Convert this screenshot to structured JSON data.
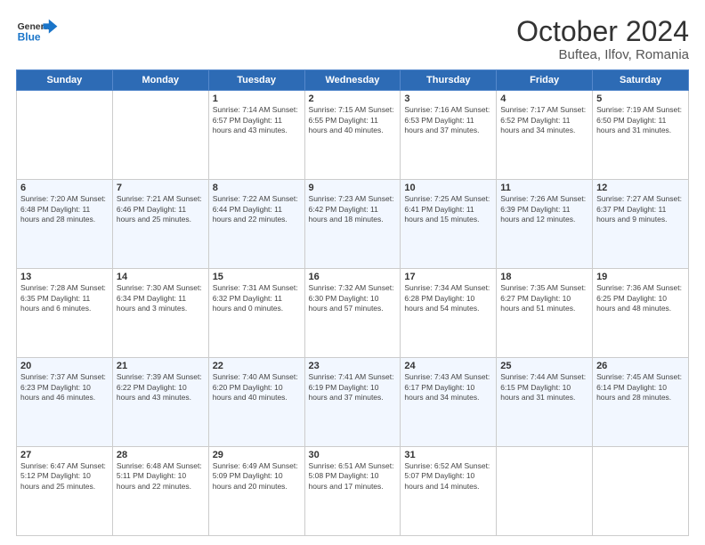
{
  "header": {
    "logo_line1": "General",
    "logo_line2": "Blue",
    "month": "October 2024",
    "location": "Buftea, Ilfov, Romania"
  },
  "weekdays": [
    "Sunday",
    "Monday",
    "Tuesday",
    "Wednesday",
    "Thursday",
    "Friday",
    "Saturday"
  ],
  "weeks": [
    [
      {
        "day": "",
        "info": ""
      },
      {
        "day": "",
        "info": ""
      },
      {
        "day": "1",
        "info": "Sunrise: 7:14 AM\nSunset: 6:57 PM\nDaylight: 11 hours and 43 minutes."
      },
      {
        "day": "2",
        "info": "Sunrise: 7:15 AM\nSunset: 6:55 PM\nDaylight: 11 hours and 40 minutes."
      },
      {
        "day": "3",
        "info": "Sunrise: 7:16 AM\nSunset: 6:53 PM\nDaylight: 11 hours and 37 minutes."
      },
      {
        "day": "4",
        "info": "Sunrise: 7:17 AM\nSunset: 6:52 PM\nDaylight: 11 hours and 34 minutes."
      },
      {
        "day": "5",
        "info": "Sunrise: 7:19 AM\nSunset: 6:50 PM\nDaylight: 11 hours and 31 minutes."
      }
    ],
    [
      {
        "day": "6",
        "info": "Sunrise: 7:20 AM\nSunset: 6:48 PM\nDaylight: 11 hours and 28 minutes."
      },
      {
        "day": "7",
        "info": "Sunrise: 7:21 AM\nSunset: 6:46 PM\nDaylight: 11 hours and 25 minutes."
      },
      {
        "day": "8",
        "info": "Sunrise: 7:22 AM\nSunset: 6:44 PM\nDaylight: 11 hours and 22 minutes."
      },
      {
        "day": "9",
        "info": "Sunrise: 7:23 AM\nSunset: 6:42 PM\nDaylight: 11 hours and 18 minutes."
      },
      {
        "day": "10",
        "info": "Sunrise: 7:25 AM\nSunset: 6:41 PM\nDaylight: 11 hours and 15 minutes."
      },
      {
        "day": "11",
        "info": "Sunrise: 7:26 AM\nSunset: 6:39 PM\nDaylight: 11 hours and 12 minutes."
      },
      {
        "day": "12",
        "info": "Sunrise: 7:27 AM\nSunset: 6:37 PM\nDaylight: 11 hours and 9 minutes."
      }
    ],
    [
      {
        "day": "13",
        "info": "Sunrise: 7:28 AM\nSunset: 6:35 PM\nDaylight: 11 hours and 6 minutes."
      },
      {
        "day": "14",
        "info": "Sunrise: 7:30 AM\nSunset: 6:34 PM\nDaylight: 11 hours and 3 minutes."
      },
      {
        "day": "15",
        "info": "Sunrise: 7:31 AM\nSunset: 6:32 PM\nDaylight: 11 hours and 0 minutes."
      },
      {
        "day": "16",
        "info": "Sunrise: 7:32 AM\nSunset: 6:30 PM\nDaylight: 10 hours and 57 minutes."
      },
      {
        "day": "17",
        "info": "Sunrise: 7:34 AM\nSunset: 6:28 PM\nDaylight: 10 hours and 54 minutes."
      },
      {
        "day": "18",
        "info": "Sunrise: 7:35 AM\nSunset: 6:27 PM\nDaylight: 10 hours and 51 minutes."
      },
      {
        "day": "19",
        "info": "Sunrise: 7:36 AM\nSunset: 6:25 PM\nDaylight: 10 hours and 48 minutes."
      }
    ],
    [
      {
        "day": "20",
        "info": "Sunrise: 7:37 AM\nSunset: 6:23 PM\nDaylight: 10 hours and 46 minutes."
      },
      {
        "day": "21",
        "info": "Sunrise: 7:39 AM\nSunset: 6:22 PM\nDaylight: 10 hours and 43 minutes."
      },
      {
        "day": "22",
        "info": "Sunrise: 7:40 AM\nSunset: 6:20 PM\nDaylight: 10 hours and 40 minutes."
      },
      {
        "day": "23",
        "info": "Sunrise: 7:41 AM\nSunset: 6:19 PM\nDaylight: 10 hours and 37 minutes."
      },
      {
        "day": "24",
        "info": "Sunrise: 7:43 AM\nSunset: 6:17 PM\nDaylight: 10 hours and 34 minutes."
      },
      {
        "day": "25",
        "info": "Sunrise: 7:44 AM\nSunset: 6:15 PM\nDaylight: 10 hours and 31 minutes."
      },
      {
        "day": "26",
        "info": "Sunrise: 7:45 AM\nSunset: 6:14 PM\nDaylight: 10 hours and 28 minutes."
      }
    ],
    [
      {
        "day": "27",
        "info": "Sunrise: 6:47 AM\nSunset: 5:12 PM\nDaylight: 10 hours and 25 minutes."
      },
      {
        "day": "28",
        "info": "Sunrise: 6:48 AM\nSunset: 5:11 PM\nDaylight: 10 hours and 22 minutes."
      },
      {
        "day": "29",
        "info": "Sunrise: 6:49 AM\nSunset: 5:09 PM\nDaylight: 10 hours and 20 minutes."
      },
      {
        "day": "30",
        "info": "Sunrise: 6:51 AM\nSunset: 5:08 PM\nDaylight: 10 hours and 17 minutes."
      },
      {
        "day": "31",
        "info": "Sunrise: 6:52 AM\nSunset: 5:07 PM\nDaylight: 10 hours and 14 minutes."
      },
      {
        "day": "",
        "info": ""
      },
      {
        "day": "",
        "info": ""
      }
    ]
  ]
}
